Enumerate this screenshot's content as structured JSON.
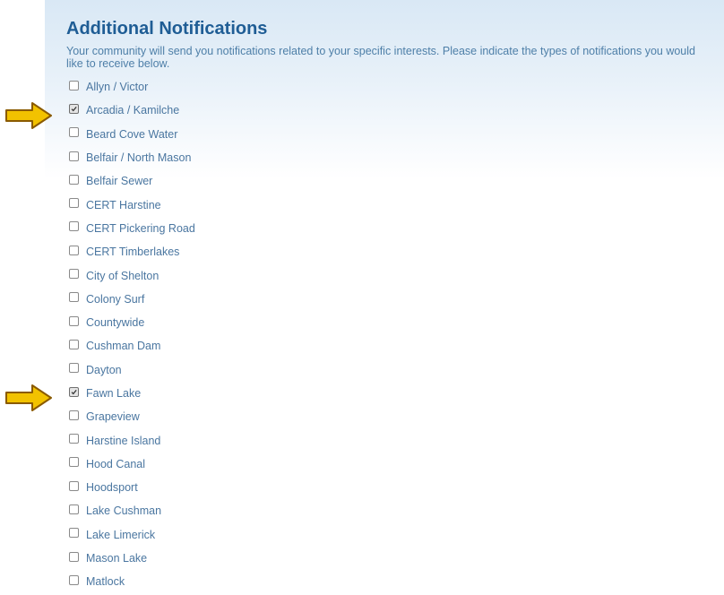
{
  "section": {
    "title": "Additional Notifications",
    "description": "Your community will send you notifications related to your specific interests. Please indicate the types of notifications you would like to receive below."
  },
  "options": [
    {
      "label": "Allyn / Victor",
      "checked": false
    },
    {
      "label": "Arcadia / Kamilche",
      "checked": true
    },
    {
      "label": "Beard Cove Water",
      "checked": false
    },
    {
      "label": "Belfair / North Mason",
      "checked": false
    },
    {
      "label": "Belfair Sewer",
      "checked": false
    },
    {
      "label": "CERT Harstine",
      "checked": false
    },
    {
      "label": "CERT Pickering Road",
      "checked": false
    },
    {
      "label": "CERT Timberlakes",
      "checked": false
    },
    {
      "label": "City of Shelton",
      "checked": false
    },
    {
      "label": "Colony Surf",
      "checked": false
    },
    {
      "label": "Countywide",
      "checked": false
    },
    {
      "label": "Cushman Dam",
      "checked": false
    },
    {
      "label": "Dayton",
      "checked": false
    },
    {
      "label": "Fawn Lake",
      "checked": true
    },
    {
      "label": "Grapeview",
      "checked": false
    },
    {
      "label": "Harstine Island",
      "checked": false
    },
    {
      "label": "Hood Canal",
      "checked": false
    },
    {
      "label": "Hoodsport",
      "checked": false
    },
    {
      "label": "Lake Cushman",
      "checked": false
    },
    {
      "label": "Lake Limerick",
      "checked": false
    },
    {
      "label": "Mason Lake",
      "checked": false
    },
    {
      "label": "Matlock",
      "checked": false
    }
  ],
  "annotations": {
    "arrow_icon": "right-arrow-icon",
    "arrow_fill": "#f2c200",
    "arrow_stroke": "#8a5a00"
  }
}
